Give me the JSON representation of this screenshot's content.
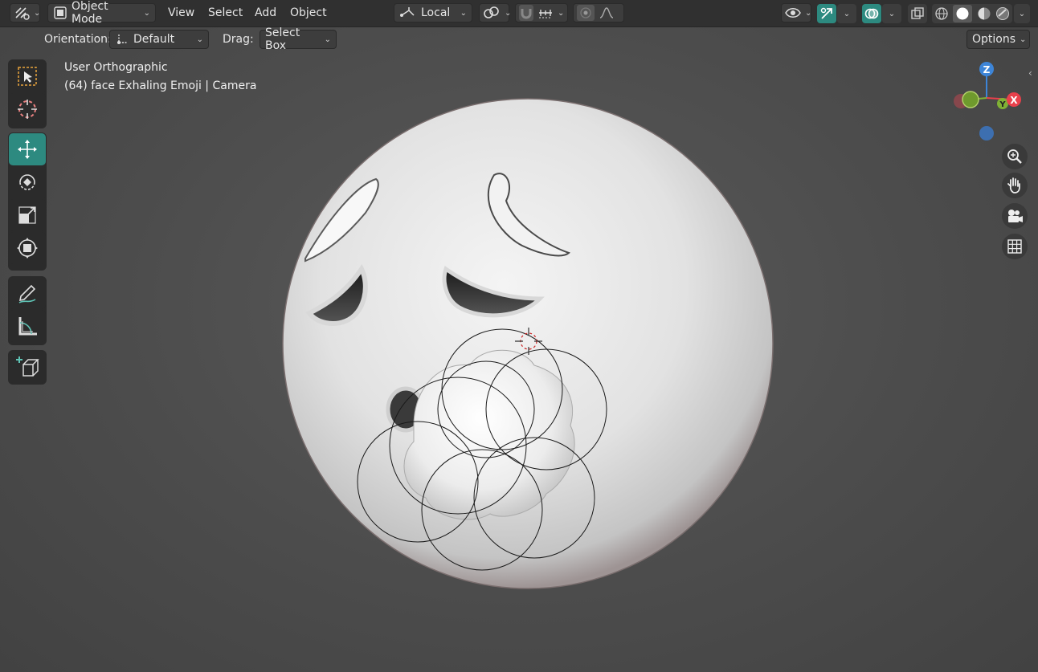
{
  "header": {
    "editor_type_icon": "transform-gizmo-icon",
    "mode": {
      "label": "Object Mode",
      "icon": "object-mode-icon"
    },
    "menus": [
      "View",
      "Select",
      "Add",
      "Object"
    ],
    "transform_space": {
      "label": "Local",
      "icon": "local-orientation-icon"
    },
    "pivot_icon": "pivot-link-icon",
    "snap_icon": "magnet-snap-icon",
    "snap_increment_icon": "snap-increment-icon",
    "proportional_icon": "proportional-edit-icon",
    "falloff_icon": "falloff-curve-icon",
    "visibility_icon": "eye-icon",
    "gizmo_icon": "gizmo-arrow-icon",
    "overlay_icon": "overlay-circles-icon",
    "xray_icon": "xray-icon",
    "shading_modes": [
      "wireframe",
      "solid",
      "material",
      "rendered"
    ],
    "active_shading": "solid"
  },
  "subheader": {
    "orientation_label": "Orientation:",
    "orientation_value": "Default",
    "drag_label": "Drag:",
    "drag_value": "Select Box",
    "options_label": "Options"
  },
  "viewport": {
    "view_name": "User Orthographic",
    "object_info": "(64) face Exhaling Emoji | Camera"
  },
  "tools": [
    {
      "name": "select-box",
      "icon": "select-box-icon",
      "active": false
    },
    {
      "name": "cursor",
      "icon": "cursor-icon",
      "active": false
    },
    {
      "name": "move",
      "icon": "move-icon",
      "active": true
    },
    {
      "name": "rotate",
      "icon": "rotate-icon",
      "active": false
    },
    {
      "name": "scale",
      "icon": "scale-icon",
      "active": false
    },
    {
      "name": "transform",
      "icon": "transform-icon",
      "active": false
    },
    {
      "name": "annotate",
      "icon": "annotate-icon",
      "active": false
    },
    {
      "name": "measure",
      "icon": "measure-icon",
      "active": false
    },
    {
      "name": "add-cube",
      "icon": "add-cube-icon",
      "active": false
    }
  ],
  "gizmo": {
    "z": "Z",
    "y": "Y",
    "x": "X",
    "colors": {
      "x": "#e8404b",
      "y": "#7fb135",
      "z": "#3d85d8"
    }
  },
  "nav_buttons": [
    "zoom-icon",
    "pan-hand-icon",
    "camera-icon",
    "ortho-grid-icon"
  ],
  "colors": {
    "accent": "#2d8a80",
    "header": "#303030",
    "background": "#4c4c4c"
  }
}
